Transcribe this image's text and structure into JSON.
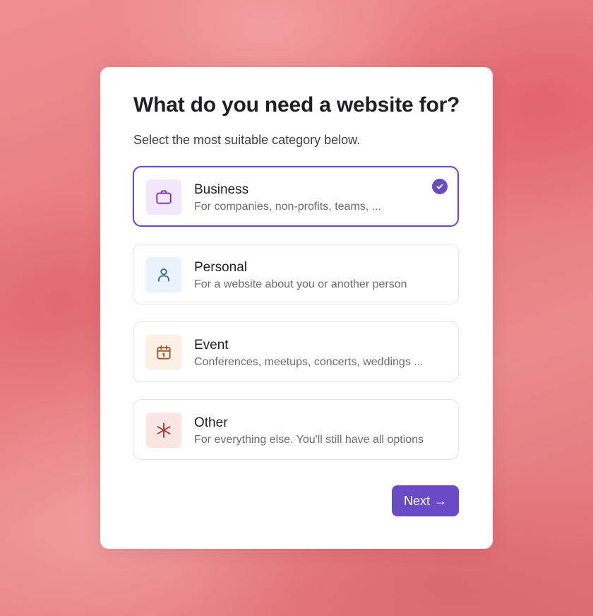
{
  "title": "What do you need a website for?",
  "subtitle": "Select the most suitable category below.",
  "options": [
    {
      "label": "Business",
      "description": "For companies, non-profits, teams, ...",
      "icon": "briefcase-icon",
      "icon_color": "#7b2fa6",
      "icon_bg": "#f3e8fb",
      "selected": true
    },
    {
      "label": "Personal",
      "description": "For a website about you or another person",
      "icon": "person-icon",
      "icon_color": "#3b6a8c",
      "icon_bg": "#e8f3fb",
      "selected": false
    },
    {
      "label": "Event",
      "description": "Conferences, meetups, concerts, weddings ...",
      "icon": "calendar-icon",
      "icon_color": "#a0582a",
      "icon_bg": "#fcefe4",
      "selected": false
    },
    {
      "label": "Other",
      "description": "For everything else. You'll still have all options",
      "icon": "asterisk-icon",
      "icon_color": "#a8352e",
      "icon_bg": "#fbe6e3",
      "selected": false
    }
  ],
  "next_label": "Next",
  "next_arrow": "→",
  "accent_color": "#6a4bc7"
}
